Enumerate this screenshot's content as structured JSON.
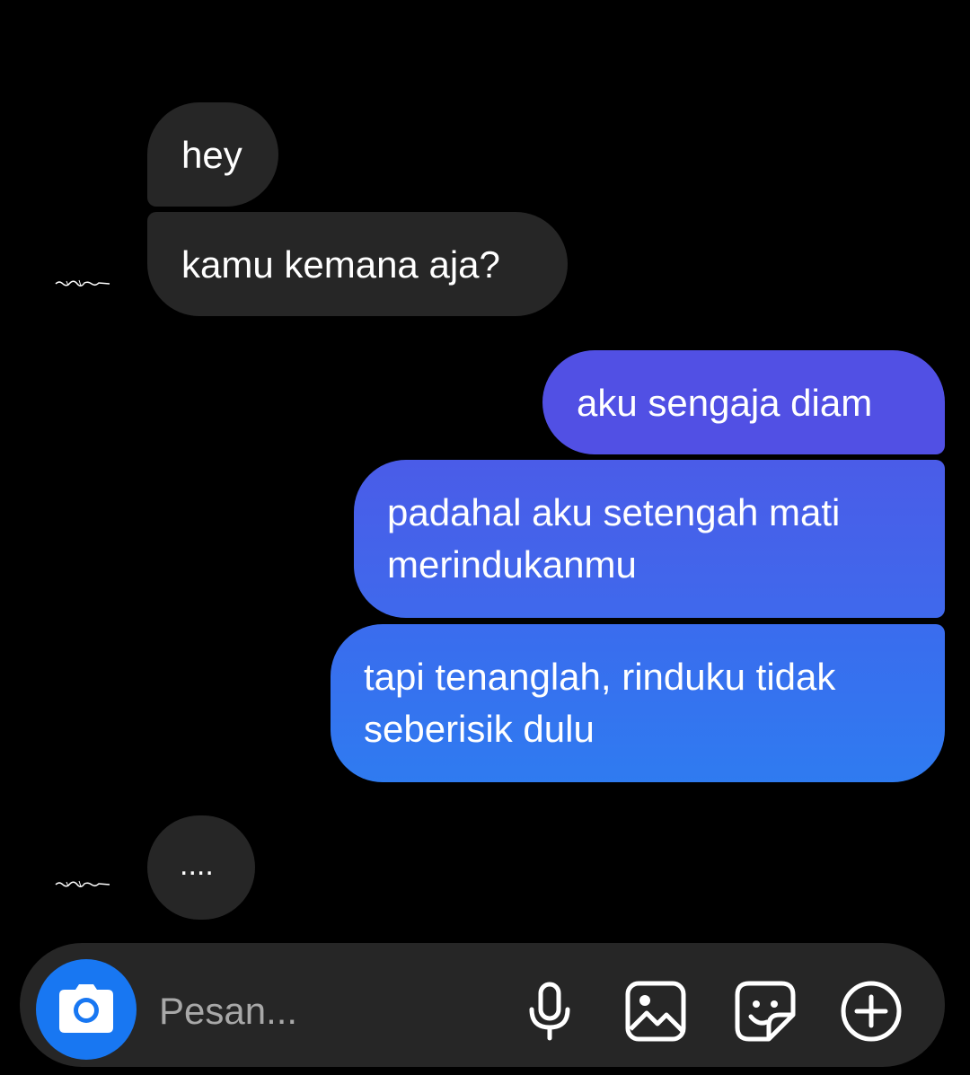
{
  "messages": [
    {
      "direction": "incoming",
      "text": "hey"
    },
    {
      "direction": "incoming",
      "text": "kamu kemana aja?"
    },
    {
      "direction": "outgoing",
      "text": "aku sengaja diam"
    },
    {
      "direction": "outgoing",
      "lines": [
        "padahal aku setengah mati",
        "merindukanmu"
      ]
    },
    {
      "direction": "outgoing",
      "lines": [
        "tapi tenanglah, rinduku tidak",
        "seberisik dulu"
      ]
    },
    {
      "direction": "incoming",
      "text": "...."
    }
  ],
  "composer": {
    "placeholder": "Pesan...",
    "icons": [
      "camera-icon",
      "microphone-icon",
      "gallery-icon",
      "sticker-icon",
      "add-icon"
    ]
  },
  "colors": {
    "background": "#000000",
    "incoming_bubble": "#262626",
    "outgoing_gradient_top": "#5b4fe0",
    "outgoing_gradient_bottom": "#2f7bf0",
    "camera_button": "#1877f2",
    "placeholder": "#a8a8a8"
  }
}
